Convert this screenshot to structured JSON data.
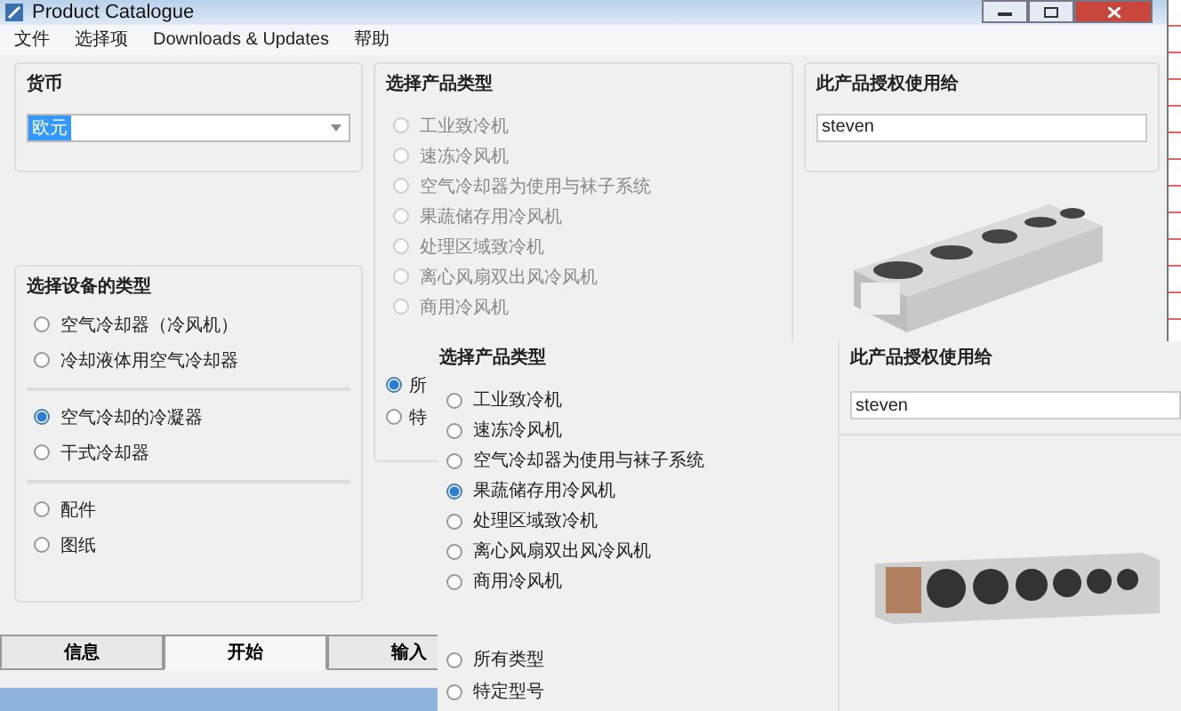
{
  "window": {
    "title": "Product Catalogue"
  },
  "menu": [
    "文件",
    "选择项",
    "Downloads & Updates",
    "帮助"
  ],
  "currency": {
    "label": "货币",
    "value": "欧元"
  },
  "equipment_type": {
    "label": "选择设备的类型",
    "groups": [
      [
        {
          "label": "空气冷却器（冷风机）",
          "selected": false
        },
        {
          "label": "冷却液体用空气冷却器",
          "selected": false
        }
      ],
      [
        {
          "label": "空气冷却的冷凝器",
          "selected": true
        },
        {
          "label": "干式冷却器",
          "selected": false
        }
      ],
      [
        {
          "label": "配件",
          "selected": false
        },
        {
          "label": "图纸",
          "selected": false
        }
      ]
    ]
  },
  "product_type": {
    "label": "选择产品类型",
    "disabled": true,
    "options": [
      {
        "label": "工业致冷机",
        "selected": false
      },
      {
        "label": "速冻冷风机",
        "selected": false
      },
      {
        "label": "空气冷却器为使用与袜子系统",
        "selected": false
      },
      {
        "label": "果蔬储存用冷风机",
        "selected": false
      },
      {
        "label": "处理区域致冷机",
        "selected": false
      },
      {
        "label": "离心风扇双出风冷风机",
        "selected": false
      },
      {
        "label": "商用冷风机",
        "selected": false
      }
    ],
    "scope_options": [
      {
        "label": "所",
        "selected": true
      },
      {
        "label": "特",
        "selected": false
      }
    ]
  },
  "license": {
    "label": "此产品授权使用给",
    "value": "steven"
  },
  "tabs": [
    {
      "label": "信息",
      "selected": false
    },
    {
      "label": "开始",
      "selected": true
    },
    {
      "label": "输入",
      "selected": false
    }
  ],
  "overlay": {
    "product_type": {
      "label": "选择产品类型",
      "disabled": false,
      "options": [
        {
          "label": "工业致冷机",
          "selected": false
        },
        {
          "label": "速冻冷风机",
          "selected": false
        },
        {
          "label": "空气冷却器为使用与袜子系统",
          "selected": false
        },
        {
          "label": "果蔬储存用冷风机",
          "selected": true
        },
        {
          "label": "处理区域致冷机",
          "selected": false
        },
        {
          "label": "离心风扇双出风冷风机",
          "selected": false
        },
        {
          "label": "商用冷风机",
          "selected": false
        }
      ],
      "scope_options": [
        {
          "label": "所有类型",
          "selected": false
        },
        {
          "label": "特定型号",
          "selected": false
        }
      ]
    },
    "license": {
      "label": "此产品授权使用给",
      "value": "steven"
    }
  }
}
